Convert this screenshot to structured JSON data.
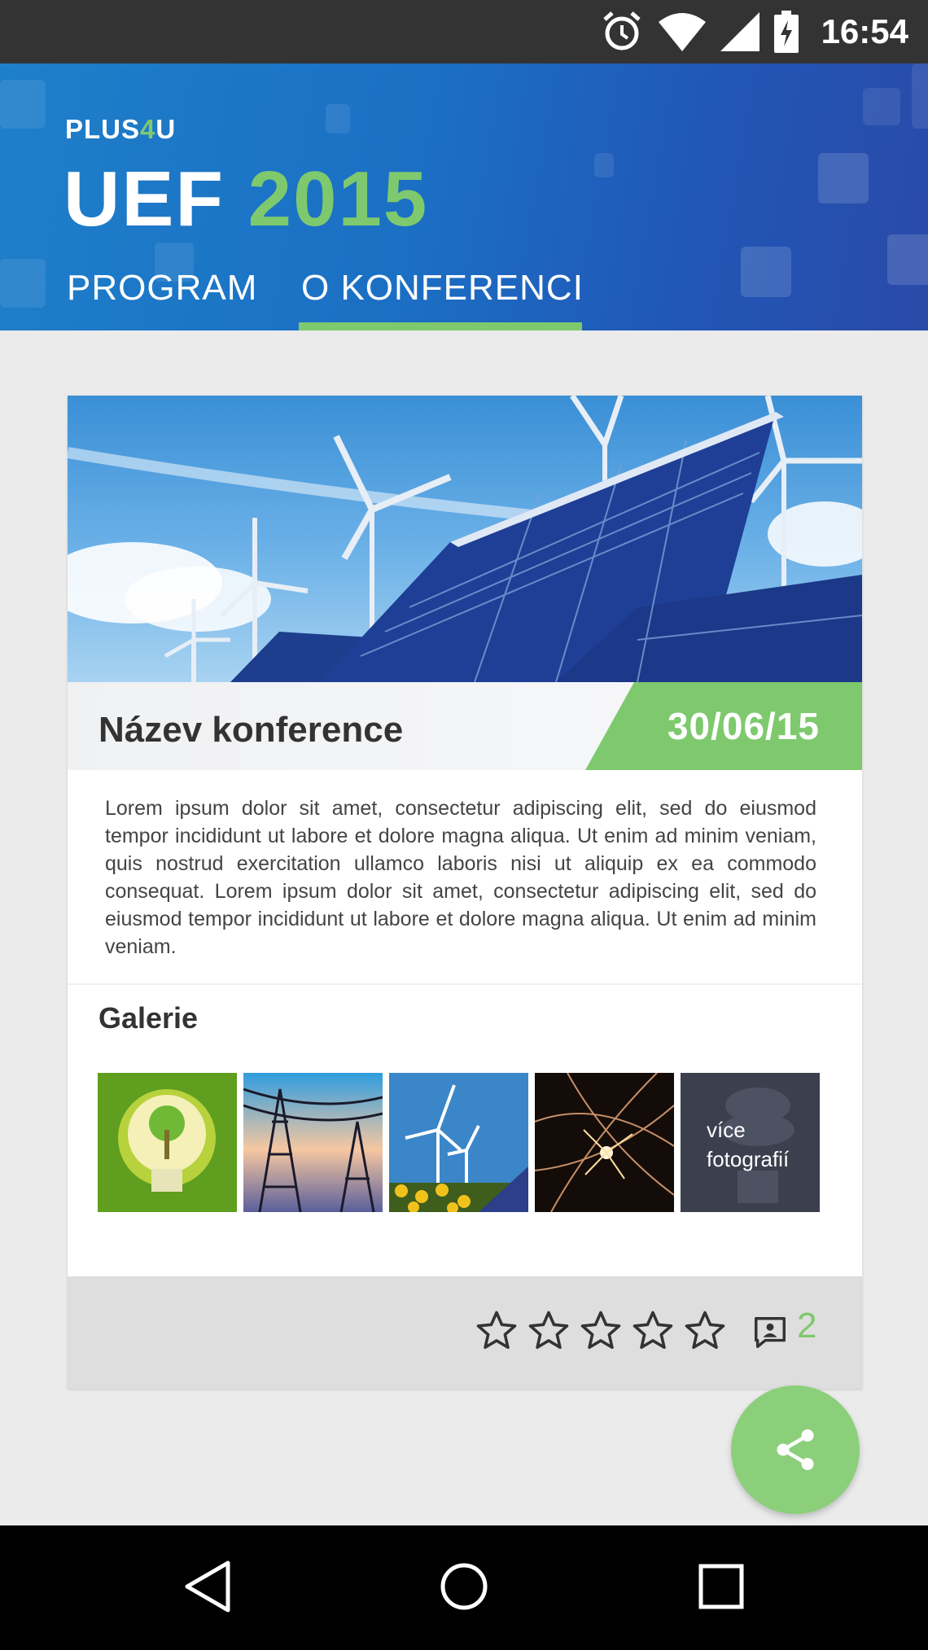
{
  "status_bar": {
    "time": "16:54",
    "icons": [
      "alarm-icon",
      "wifi-icon",
      "signal-icon",
      "battery-charging-icon"
    ]
  },
  "header": {
    "brand_prefix": "PLUS",
    "brand_mid": "4",
    "brand_suffix": "U",
    "title_main": "UEF",
    "title_year": "2015",
    "tabs": [
      {
        "label": "PROGRAM",
        "active": false
      },
      {
        "label": "O KONFERENCI",
        "active": true
      }
    ],
    "accent_color": "#7ec96e"
  },
  "card": {
    "conference_name": "Název konference",
    "date": "30/06/15",
    "description": "Lorem ipsum dolor sit amet, consectetur adipiscing elit, sed do eiusmod tempor incididunt ut labore et dolore magna aliqua. Ut enim ad minim veniam, quis nostrud exercitation ullamco laboris nisi ut aliquip ex ea commodo consequat. Lorem ipsum dolor sit amet, consectetur adipiscing elit, sed do eiusmod tempor incididunt ut labore et dolore magna aliqua. Ut enim ad minim veniam.",
    "gallery": {
      "title": "Galerie",
      "more_label_line1": "více",
      "more_label_line2": "fotografií"
    },
    "rating": {
      "stars_filled": 0,
      "stars_total": 5
    },
    "comment_count": "2"
  },
  "fab": {
    "icon": "share-icon"
  },
  "nav_bar": {
    "icons": [
      "back-icon",
      "home-icon",
      "recents-icon"
    ]
  }
}
